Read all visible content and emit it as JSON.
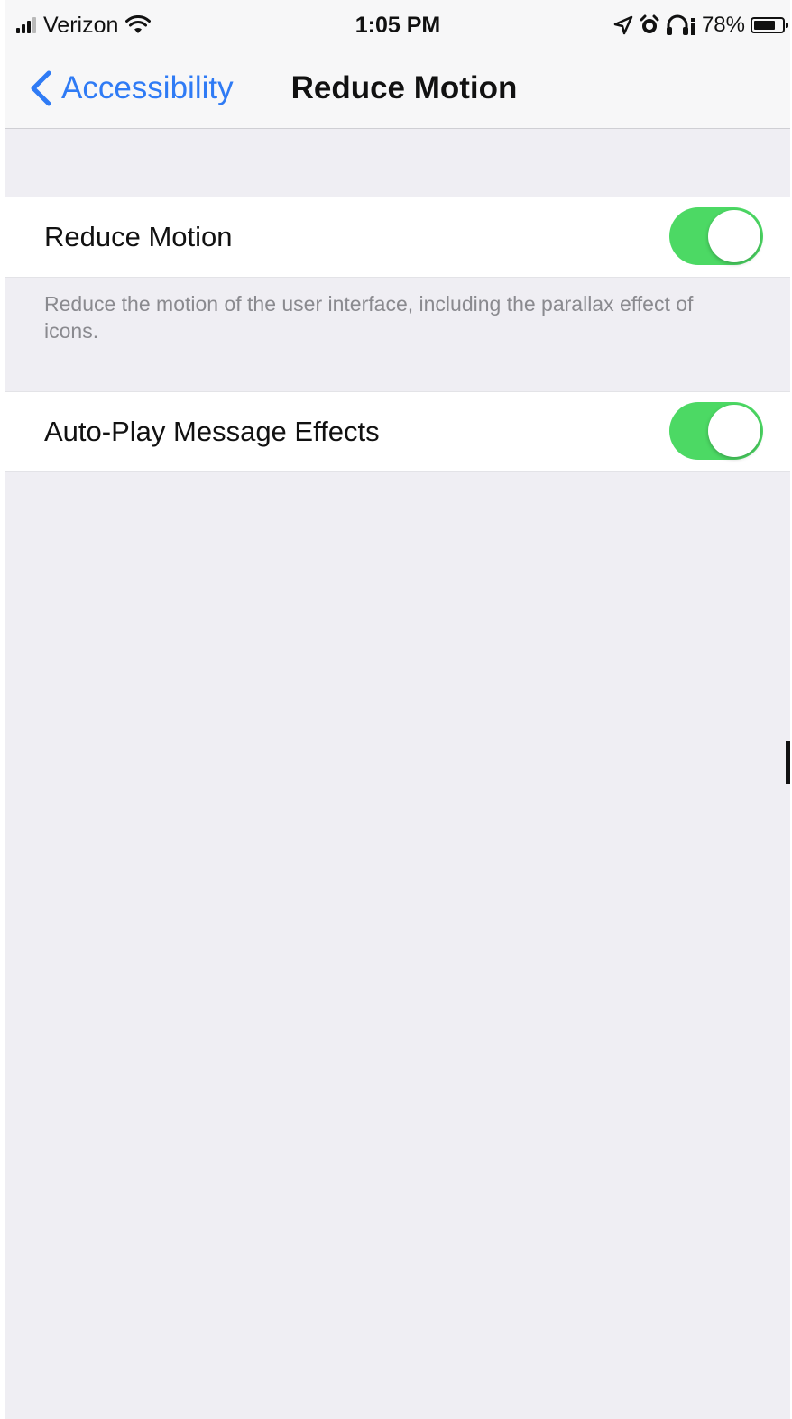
{
  "status_bar": {
    "carrier": "Verizon",
    "time": "1:05 PM",
    "battery_percent_label": "78%",
    "battery_level": 0.78,
    "icons": [
      "signal-icon",
      "wifi-icon",
      "location-arrow-icon",
      "alarm-icon",
      "headphones-icon",
      "battery-icon"
    ]
  },
  "nav": {
    "back_label": "Accessibility",
    "title": "Reduce Motion",
    "accent_color": "#2f7bf5"
  },
  "settings": {
    "reduce_motion": {
      "label": "Reduce Motion",
      "enabled": true,
      "footer": "Reduce the motion of the user interface, including the parallax effect of icons."
    },
    "auto_play_effects": {
      "label": "Auto-Play Message Effects",
      "enabled": true
    }
  },
  "colors": {
    "toggle_on": "#4cd964",
    "background": "#efeef3",
    "cell_background": "#ffffff",
    "footer_text": "#8a8a8f"
  }
}
